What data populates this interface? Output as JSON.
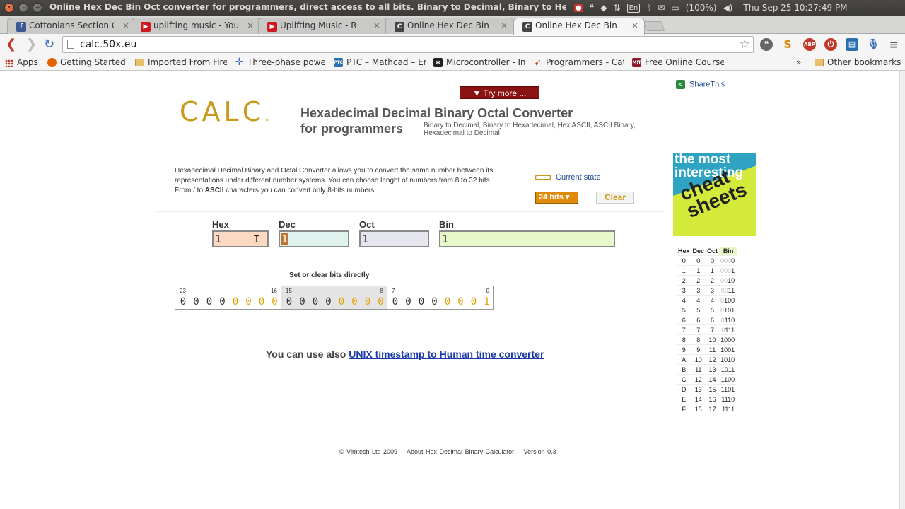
{
  "os": {
    "window_title": "Online Hex Dec Bin Oct converter for programmers, direct access to all bits. Binary to Decimal, Binary to Hexadecimal, Hex Ascii, ...",
    "lang": "En",
    "battery": "(100%)",
    "clock": "Thu Sep 25 10:27:49 PM"
  },
  "tabs": [
    {
      "label": "Cottonians Section C",
      "favicon": "facebook-icon",
      "color": "#3b5998"
    },
    {
      "label": "uplifting music - YouTube",
      "favicon": "youtube-icon",
      "color": "#cc181e"
    },
    {
      "label": "Uplifting Music - R",
      "favicon": "youtube-icon",
      "color": "#cc181e"
    },
    {
      "label": "Online Hex Dec Bin Oct",
      "favicon": "calc-icon",
      "color": "#444"
    },
    {
      "label": "Online Hex Dec Bin Oct",
      "favicon": "calc-icon",
      "color": "#444"
    }
  ],
  "toolbar": {
    "url": "calc.50x.eu"
  },
  "bookmarks": [
    {
      "label": "Apps",
      "icon": "apps-icon"
    },
    {
      "label": "Getting Started",
      "icon": "firefox-icon",
      "color": "#e66000"
    },
    {
      "label": "Imported From Firefox",
      "icon": "folder-icon"
    },
    {
      "label": "Three-phase power",
      "icon": "cross-icon",
      "color": "#3b6fc2"
    },
    {
      "label": "PTC – Mathcad – En",
      "icon": "ptc-icon",
      "color": "#2a6fb0"
    },
    {
      "label": "Microcontroller - Im",
      "icon": "chip-icon",
      "color": "#222"
    },
    {
      "label": "Programmers - Cat",
      "icon": "pin-icon",
      "color": "#c0392b"
    },
    {
      "label": "Free Online Course",
      "icon": "mit-icon",
      "color": "#8a1c2b"
    },
    {
      "label": "Other bookmarks",
      "icon": "folder-icon"
    }
  ],
  "page": {
    "try_more": "▼ Try more ...",
    "logo": "CALC",
    "title_line1": "Hexadecimal Decimal Binary Octal Converter",
    "title_line2": "for programmers",
    "subtitle": "Binary to Decimal, Binary to Hexadecimal, Hex ASCII, ASCII Binary, Hexadecimal to Decimal",
    "share": "ShareThis",
    "intro_a": "Hexadecimal Decimal Binary and Octal Converter allows you to convert the same number between its representations under different number systems. You can choose lenght of numbers from 8 to 32 bits. From / to ",
    "intro_b": "ASCII",
    "intro_c": " characters you can convert only 8-bits numbers.",
    "current_state": "Current state",
    "bits_select": "24 bits ▾",
    "clear": "Clear",
    "fields": {
      "hex_label": "Hex",
      "hex_value": "1",
      "dec_label": "Dec",
      "dec_value": "1",
      "oct_label": "Oct",
      "oct_value": "1",
      "bin_label": "Bin",
      "bin_value": "1"
    },
    "bits_title": "Set or clear bits directly",
    "bit_groups": [
      {
        "hi": "23",
        "lo": "16",
        "bits": [
          "0",
          "0",
          "0",
          "0",
          "0",
          "0",
          "0",
          "0"
        ],
        "shaded": false
      },
      {
        "hi": "15",
        "lo": "8",
        "bits": [
          "0",
          "0",
          "0",
          "0",
          "0",
          "0",
          "0",
          "0"
        ],
        "shaded": true
      },
      {
        "hi": "7",
        "lo": "0",
        "bits": [
          "0",
          "0",
          "0",
          "0",
          "0",
          "0",
          "0",
          "1"
        ],
        "shaded": false
      }
    ],
    "unix_prefix": "You can use also ",
    "unix_link": "UNIX timestamp to Human time converter",
    "footer": [
      "© Vimtech Ltd 2009",
      "About Hex Decimal Binary Calculator",
      "Version 0.3"
    ],
    "ad": {
      "line1": "the most interesting",
      "line2": "cheat sheets"
    },
    "ref_headers": [
      "Hex",
      "Dec",
      "Oct",
      "Bin"
    ],
    "ref_rows": [
      [
        "0",
        "0",
        "0",
        "0000"
      ],
      [
        "1",
        "1",
        "1",
        "0001"
      ],
      [
        "2",
        "2",
        "2",
        "0010"
      ],
      [
        "3",
        "3",
        "3",
        "0011"
      ],
      [
        "4",
        "4",
        "4",
        "0100"
      ],
      [
        "5",
        "5",
        "5",
        "0101"
      ],
      [
        "6",
        "6",
        "6",
        "0110"
      ],
      [
        "7",
        "7",
        "7",
        "0111"
      ],
      [
        "8",
        "8",
        "10",
        "1000"
      ],
      [
        "9",
        "9",
        "11",
        "1001"
      ],
      [
        "A",
        "10",
        "12",
        "1010"
      ],
      [
        "B",
        "11",
        "13",
        "1011"
      ],
      [
        "C",
        "12",
        "14",
        "1100"
      ],
      [
        "D",
        "13",
        "15",
        "1101"
      ],
      [
        "E",
        "14",
        "16",
        "1110"
      ],
      [
        "F",
        "15",
        "17",
        "1111"
      ]
    ],
    "colors": {
      "orange_bit": "#e0a000",
      "dark_bit": "#333333",
      "accent": "#c9991c"
    }
  }
}
